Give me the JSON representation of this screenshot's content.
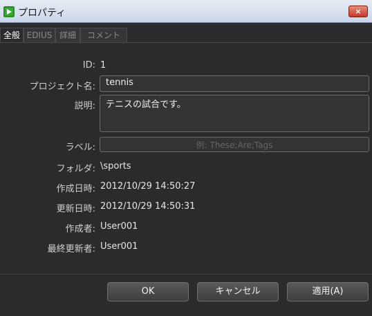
{
  "window": {
    "title": "プロパティ",
    "close_label": "×"
  },
  "tabs": [
    {
      "label": "全般",
      "active": true
    },
    {
      "label": "EDIUS",
      "active": false
    },
    {
      "label": "詳細",
      "active": false
    },
    {
      "label": "コメント",
      "active": false
    }
  ],
  "fields": {
    "id": {
      "label": "ID:",
      "value": "1"
    },
    "project_name": {
      "label": "プロジェクト名:",
      "value": "tennis"
    },
    "description": {
      "label": "説明:",
      "value": "テニスの試合です。"
    },
    "label_field": {
      "label": "ラベル:",
      "value": "",
      "placeholder": "例: These;Are;Tags"
    },
    "folder": {
      "label": "フォルダ:",
      "value": "\\sports"
    },
    "created": {
      "label": "作成日時:",
      "value": "2012/10/29 14:50:27"
    },
    "updated": {
      "label": "更新日時:",
      "value": "2012/10/29 14:50:31"
    },
    "creator": {
      "label": "作成者:",
      "value": "User001"
    },
    "last_modifier": {
      "label": "最終更新者:",
      "value": "User001"
    }
  },
  "buttons": {
    "ok": "OK",
    "cancel": "キャンセル",
    "apply": "適用(A)"
  },
  "colors": {
    "background": "#2b2b2b",
    "titlebar": "#d6e0ef",
    "close": "#c0392b",
    "text": "#e6e6e6"
  }
}
